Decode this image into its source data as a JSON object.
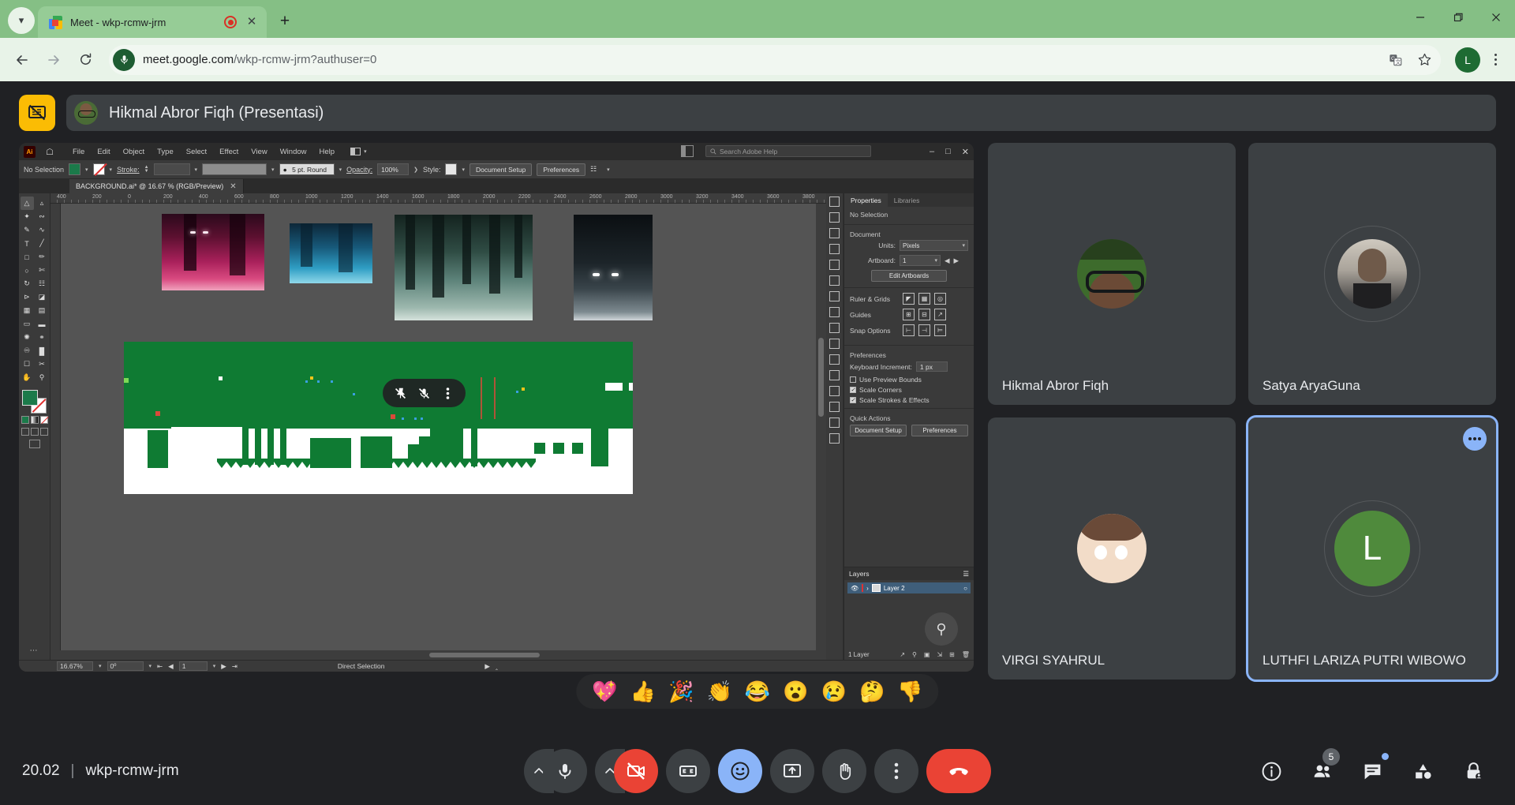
{
  "browser": {
    "tab": {
      "title": "Meet - wkp-rcmw-jrm",
      "favicon_icon": "google-meet-favicon",
      "recording_icon": "recording-indicator-icon",
      "close_icon": "close-icon"
    },
    "new_tab_label": "+",
    "tabstrip_chevron_icon": "chevron-down-icon",
    "window": {
      "minimize_icon": "minimize-icon",
      "restore_icon": "restore-icon",
      "close_icon": "window-close-icon"
    },
    "nav": {
      "back_icon": "back-arrow-icon",
      "forward_icon": "forward-arrow-icon",
      "reload_icon": "reload-icon"
    },
    "omnibox": {
      "url_main": "meet.google.com",
      "url_path": "/wkp-rcmw-jrm?authuser=0",
      "site_icon": "microphone-permission-icon",
      "translate_icon": "translate-icon",
      "bookmark_icon": "star-icon"
    },
    "profile_initial": "L",
    "menu_icon": "three-dot-menu-icon"
  },
  "meet": {
    "header": {
      "presenting_icon": "presentation-stop-icon",
      "presenter_label": "Hikmal Abror Fiqh (Presentasi)"
    },
    "share_controls": {
      "unpin_icon": "pin-off-icon",
      "mute_icon": "mic-off-icon",
      "more_icon": "more-vert-icon"
    },
    "tiles": [
      {
        "name": "Hikmal Abror Fiqh",
        "avatar": "photo-avatar",
        "selected": false
      },
      {
        "name": "Satya AryaGuna",
        "avatar": "photo-avatar",
        "selected": false
      },
      {
        "name": "VIRGI SYAHRUL",
        "avatar": "illustration-avatar",
        "selected": false
      },
      {
        "name": "LUTHFI LARIZA PUTRI WIBOWO",
        "avatar": "initial-avatar",
        "initial": "L",
        "selected": true,
        "more_icon": "more-horiz-icon"
      }
    ],
    "reactions": [
      "💖",
      "👍",
      "🎉",
      "👏",
      "😂",
      "😮",
      "😢",
      "🤔",
      "👎"
    ],
    "bottom": {
      "time": "20.02",
      "separator": "|",
      "meeting_code": "wkp-rcmw-jrm",
      "controls": [
        {
          "name": "mic-options",
          "icon": "chevron-up-icon"
        },
        {
          "name": "microphone-button",
          "icon": "mic-icon"
        },
        {
          "name": "camera-options",
          "icon": "chevron-up-icon"
        },
        {
          "name": "camera-button",
          "icon": "video-off-icon"
        },
        {
          "name": "captions-button",
          "icon": "cc-icon"
        },
        {
          "name": "reactions-button",
          "icon": "emoji-smile-icon"
        },
        {
          "name": "present-button",
          "icon": "present-screen-icon"
        },
        {
          "name": "raise-hand-button",
          "icon": "raise-hand-icon"
        },
        {
          "name": "more-options-button",
          "icon": "more-vert-icon"
        },
        {
          "name": "leave-call-button",
          "icon": "end-call-icon"
        }
      ],
      "right_controls": [
        {
          "name": "meeting-details-button",
          "icon": "info-icon"
        },
        {
          "name": "people-button",
          "icon": "people-icon",
          "badge": "5"
        },
        {
          "name": "chat-button",
          "icon": "chat-icon",
          "has_dot": true
        },
        {
          "name": "activities-button",
          "icon": "shapes-icon"
        },
        {
          "name": "host-controls-button",
          "icon": "lock-person-icon"
        }
      ]
    }
  },
  "illustrator": {
    "app_badge": "Ai",
    "home_icon": "home-icon",
    "menus": [
      "File",
      "Edit",
      "Object",
      "Type",
      "Select",
      "Effect",
      "View",
      "Window",
      "Help"
    ],
    "arrange_icon": "arrange-documents-icon",
    "search_placeholder": "Search Adobe Help",
    "search_icon": "search-icon",
    "doc_icon": "document-arrange-icon",
    "window_controls": {
      "minimize": "–",
      "maximize": "□",
      "close": "✕"
    },
    "control_bar": {
      "selection_state": "No Selection",
      "fill_swatch_color": "#1b7a4a",
      "stroke_label": "Stroke:",
      "stroke_weight": "",
      "brush_label": "5 pt. Round",
      "opacity_label": "Opacity:",
      "opacity_value": "100%",
      "style_label": "Style:",
      "document_setup_label": "Document Setup",
      "preferences_label": "Preferences"
    },
    "document_tab": "BACKGROUND.ai* @ 16.67 % (RGB/Preview)",
    "ruler_marks": [
      "400",
      "200",
      "0",
      "200",
      "400",
      "600",
      "800",
      "1000",
      "1200",
      "1400",
      "1600",
      "1800",
      "2000",
      "2200",
      "2400",
      "2600",
      "2800",
      "3000",
      "3200",
      "3400",
      "3600",
      "3800"
    ],
    "properties": {
      "tabs": [
        "Properties",
        "Libraries"
      ],
      "active_tab": "Properties",
      "no_selection": "No Selection",
      "document_heading": "Document",
      "units_label": "Units:",
      "units_value": "Pixels",
      "artboard_label": "Artboard:",
      "artboard_value": "1",
      "edit_artboards_label": "Edit Artboards",
      "ruler_grids_label": "Ruler & Grids",
      "guides_label": "Guides",
      "snap_options_label": "Snap Options",
      "preferences_heading": "Preferences",
      "keyboard_increment_label": "Keyboard Increment:",
      "keyboard_increment_value": "1 px",
      "checkboxes": [
        {
          "label": "Use Preview Bounds",
          "checked": false
        },
        {
          "label": "Scale Corners",
          "checked": true
        },
        {
          "label": "Scale Strokes & Effects",
          "checked": true
        }
      ],
      "quick_actions_heading": "Quick Actions",
      "quick_actions": [
        "Document Setup",
        "Preferences"
      ]
    },
    "layers": {
      "title": "Layers",
      "menu_icon": "panel-menu-icon",
      "rows": [
        {
          "name": "Layer 2",
          "visible": true,
          "eye_icon": "eye-icon",
          "expand_icon": "chevron-right-icon"
        }
      ],
      "footer_count": "1 Layer",
      "footer_icons": [
        "locate-object-icon",
        "search-layer-icon",
        "duplicate-layer-icon",
        "new-sublayer-icon",
        "new-layer-icon",
        "delete-layer-icon"
      ],
      "zoom_overlay_icon": "zoom-in-icon"
    },
    "status_bar": {
      "zoom_value": "16.67%",
      "rotation_value": "0º",
      "artboard_nav_value": "1",
      "tool_status": "Direct Selection"
    },
    "toolbar_icons": [
      "selection-tool-icon",
      "direct-selection-tool-icon",
      "magic-wand-tool-icon",
      "lasso-tool-icon",
      "pen-tool-icon",
      "curvature-tool-icon",
      "type-tool-icon",
      "line-tool-icon",
      "rectangle-tool-icon",
      "paintbrush-tool-icon",
      "shaper-tool-icon",
      "scissors-tool-icon",
      "rotate-tool-icon",
      "free-transform-tool-icon",
      "width-tool-icon",
      "shape-builder-tool-icon",
      "perspective-grid-tool-icon",
      "mesh-tool-icon",
      "gradient-tool-icon",
      "gradient-swatch-icon",
      "eyedropper-tool-icon",
      "blend-tool-icon",
      "symbol-sprayer-tool-icon",
      "column-graph-tool-icon",
      "artboard-tool-icon",
      "slice-tool-icon",
      "hand-tool-icon",
      "zoom-tool-icon"
    ],
    "more_tools_icon": "more-tools-icon"
  }
}
